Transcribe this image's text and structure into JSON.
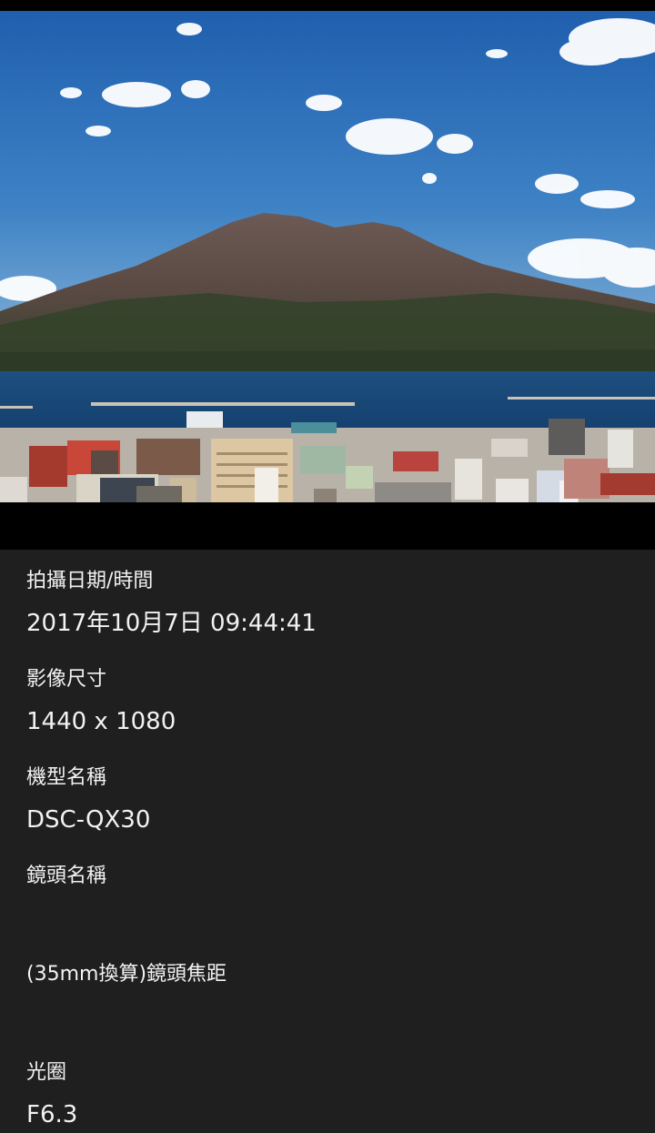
{
  "photo": {
    "subject": "photo-volcano-harbor-city"
  },
  "details": [
    {
      "label": "拍攝日期/時間",
      "value": "2017年10月7日 09:44:41"
    },
    {
      "label": "影像尺寸",
      "value": "1440 x 1080"
    },
    {
      "label": "機型名稱",
      "value": "DSC-QX30"
    },
    {
      "label": "鏡頭名稱",
      "value": ""
    },
    {
      "label": "(35mm換算)鏡頭焦距",
      "value": ""
    },
    {
      "label": "光圈",
      "value": "F6.3"
    }
  ],
  "colors": {
    "panel_background": "#1f1f20",
    "text": "#f2f2f2",
    "sky": "#2f6fb5"
  }
}
